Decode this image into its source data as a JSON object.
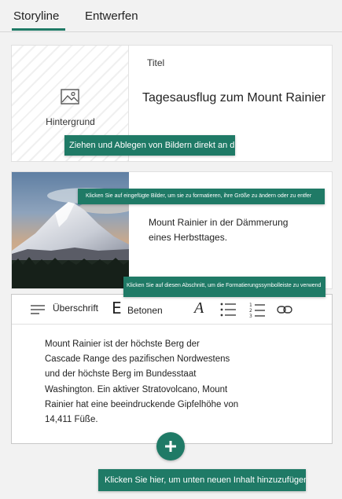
{
  "tabs": [
    {
      "label": "Storyline",
      "active": true
    },
    {
      "label": "Entwerfen",
      "active": false
    }
  ],
  "title_card": {
    "background_label": "Hintergrund",
    "title_label": "Titel",
    "title_value": "Tagesausflug zum Mount Rainier",
    "tooltip": "Ziehen und Ablegen von Bildern direkt an d"
  },
  "image_card": {
    "tooltip": "Klicken Sie auf eingefügte Bilder, um sie zu formatieren, ihre Größe zu ändern oder zu entfer",
    "caption_line1": "Mount Rainier in der Dämmerung",
    "caption_line2": "eines Herbsttages."
  },
  "text_card": {
    "tooltip": "Klicken Sie auf diesen Abschnitt, um die Formatierungssymbolleiste zu verwend",
    "toolbar": {
      "heading_label": "Überschrift",
      "emphasis_letter": "E",
      "emphasis_label": "Betonen",
      "font_letter": "A"
    },
    "body_lines": [
      "Mount Rainier ist der höchste Berg der",
      "Cascade Range des pazifischen Nordwestens",
      "und der höchste Berg im Bundesstaat",
      "Washington. Ein aktiver Stratovolcano, Mount",
      "Rainier hat eine beeindruckende Gipfelhöhe von",
      "14,411 Füße."
    ]
  },
  "add_button": {
    "tooltip": "Klicken Sie hier, um unten neuen Inhalt hinzuzufügen"
  },
  "colors": {
    "accent": "#1f7a66"
  },
  "icons": [
    "image-icon",
    "heading-icon",
    "bulleted-list-icon",
    "numbered-list-icon",
    "link-icon",
    "plus-icon"
  ]
}
